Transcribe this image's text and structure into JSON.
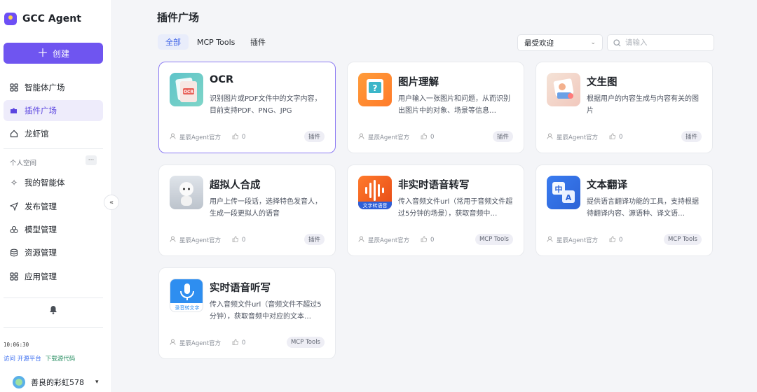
{
  "app": {
    "name": "GCC Agent"
  },
  "sidebar": {
    "create_label": "创建",
    "nav": [
      {
        "label": "智能体广场",
        "icon": "grid-icon"
      },
      {
        "label": "插件广场",
        "icon": "puzzle-icon",
        "active": true
      },
      {
        "label": "龙虾馆",
        "icon": "home-icon"
      }
    ],
    "section_title": "个人空间",
    "section_more": "···",
    "personal": [
      {
        "label": "我的智能体",
        "icon": "sparkle-icon"
      },
      {
        "label": "发布管理",
        "icon": "send-icon"
      },
      {
        "label": "模型管理",
        "icon": "cube-icon"
      },
      {
        "label": "资源管理",
        "icon": "stack-icon"
      },
      {
        "label": "应用管理",
        "icon": "apps-icon"
      }
    ],
    "time": "10:06:30",
    "link_visit": "访问 开源平台",
    "link_download": "下载源代码",
    "username": "善良的彩虹578"
  },
  "main": {
    "title": "插件广场",
    "tabs": [
      "全部",
      "MCP Tools",
      "插件"
    ],
    "active_tab": 0,
    "sort": {
      "selected": "最受欢迎"
    },
    "search": {
      "placeholder": "请输入"
    }
  },
  "cards": [
    {
      "name": "OCR",
      "desc": "识别图片或PDF文件中的文字内容，目前支持PDF、PNG、JPG",
      "author": "星辰Agent官方",
      "likes": "0",
      "tag": "插件",
      "thumb": "ocr"
    },
    {
      "name": "图片理解",
      "desc": "用户输入一张图片和问题，从而识别出图片中的对象、场景等信息…",
      "author": "星辰Agent官方",
      "likes": "0",
      "tag": "插件",
      "thumb": "img"
    },
    {
      "name": "文生图",
      "desc": "根据用户的内容生成与内容有关的图片",
      "author": "星辰Agent官方",
      "likes": "0",
      "tag": "插件",
      "thumb": "gen"
    },
    {
      "name": "超拟人合成",
      "desc": "用户上传一段话，选择特色发音人，生成一段更拟人的语音",
      "author": "星辰Agent官方",
      "likes": "0",
      "tag": "插件",
      "thumb": "human"
    },
    {
      "name": "非实时语音转写",
      "desc": "传入音频文件url（常用于音频文件超过5分钟的场景），获取音频中…",
      "author": "星辰Agent官方",
      "likes": "0",
      "tag": "MCP Tools",
      "thumb": "asr",
      "thumb_text": "文字转语音"
    },
    {
      "name": "文本翻译",
      "desc": "提供语言翻译功能的工具，支持根据待翻译内容、源语种、译文语…",
      "author": "星辰Agent官方",
      "likes": "0",
      "tag": "MCP Tools",
      "thumb": "trans",
      "thumb_text_1": "中",
      "thumb_text_2": "A"
    },
    {
      "name": "实时语音听写",
      "desc": "传入音频文件url（音频文件不超过5分钟），获取音频中对应的文本…",
      "author": "星辰Agent官方",
      "likes": "0",
      "tag": "MCP Tools",
      "thumb": "rt",
      "thumb_text": "录音转文字"
    }
  ],
  "colors": {
    "accent": "#6f55f0",
    "tab_active": "#3f63e6",
    "sidebar_active_bg": "#eeecfb"
  }
}
